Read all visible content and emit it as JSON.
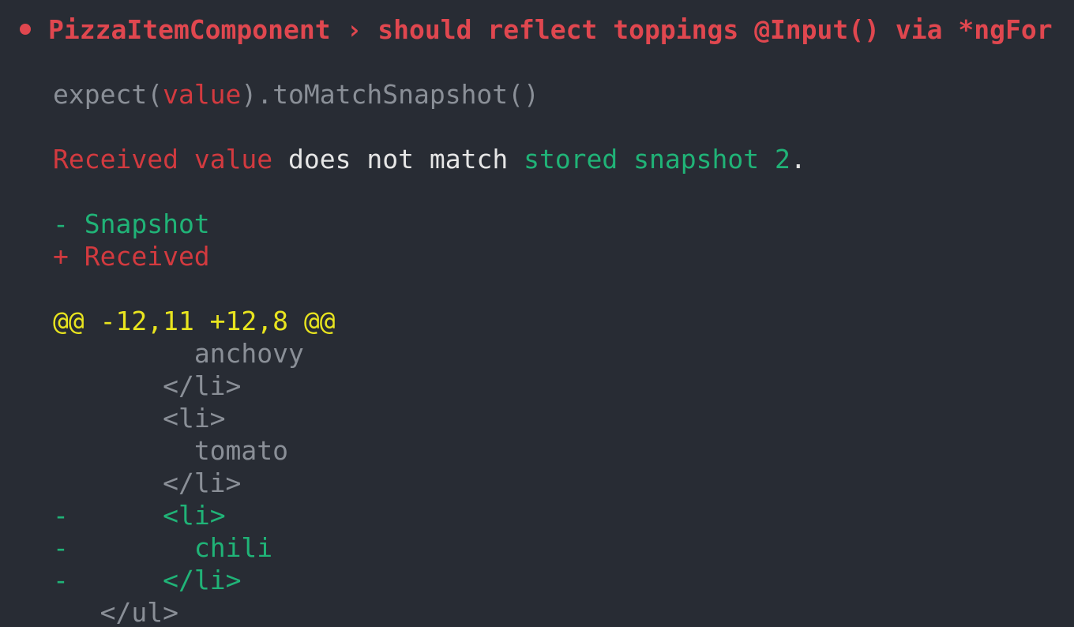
{
  "title": {
    "suite": "PizzaItemComponent",
    "separator": "›",
    "test": "should reflect toppings @Input() via *ngFor"
  },
  "matcher": {
    "prefix": "expect(",
    "arg": "value",
    "suffix": ").toMatchSnapshot()"
  },
  "message": {
    "received": "Received",
    "value": "value",
    "middle": "does not match",
    "stored": "stored snapshot",
    "number": "2",
    "period": "."
  },
  "legend": {
    "snapshot": "- Snapshot",
    "received": "+ Received"
  },
  "hunk_header": "@@ -12,11 +12,8 @@",
  "diff_lines": [
    {
      "marker": "",
      "indent": "    ",
      "text": "anchovy",
      "kind": "context"
    },
    {
      "marker": "",
      "indent": "  ",
      "text": "</li>",
      "kind": "context"
    },
    {
      "marker": "",
      "indent": "  ",
      "text": "<li>",
      "kind": "context"
    },
    {
      "marker": "",
      "indent": "    ",
      "text": "tomato",
      "kind": "context"
    },
    {
      "marker": "",
      "indent": "  ",
      "text": "</li>",
      "kind": "context"
    },
    {
      "marker": "-",
      "indent": "  ",
      "text": "<li>",
      "kind": "removed"
    },
    {
      "marker": "-",
      "indent": "    ",
      "text": "chili",
      "kind": "removed"
    },
    {
      "marker": "-",
      "indent": "  ",
      "text": "</li>",
      "kind": "removed"
    },
    {
      "marker": "",
      "indent": "",
      "text": "</ul>",
      "kind": "context"
    }
  ],
  "colors": {
    "background": "#282c34",
    "title_red": "#e0474f",
    "received_red": "#d23a3f",
    "snapshot_green": "#20b377",
    "hunk_yellow": "#e8e41f",
    "context_gray": "#8a8f97"
  }
}
